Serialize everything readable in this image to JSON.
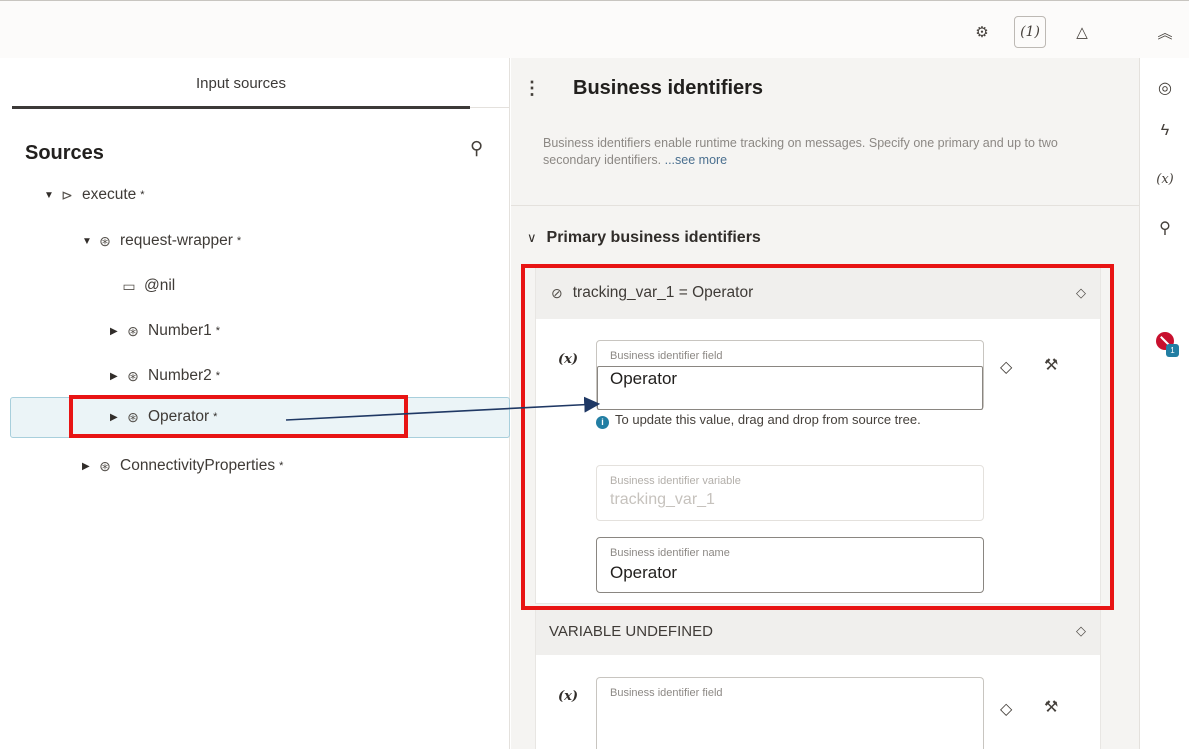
{
  "toolbar": {
    "settings_icon": "gear-icon",
    "variables_button_label": "(1)",
    "warning_icon": "warning-triangle-icon",
    "collapse_icon": "double-chevron-up-icon"
  },
  "left_panel": {
    "tab_label": "Input sources",
    "title": "Sources",
    "search_icon": "search-icon",
    "tree": [
      {
        "label": "execute",
        "expanded": true,
        "required": "*",
        "icon": "operation-icon"
      },
      {
        "label": "request-wrapper",
        "expanded": true,
        "required": "*",
        "icon": "element-icon"
      },
      {
        "label": "@nil",
        "expanded": null,
        "required": "",
        "icon": "attribute-icon"
      },
      {
        "label": "Number1",
        "expanded": false,
        "required": "*",
        "icon": "element-icon"
      },
      {
        "label": "Number2",
        "expanded": false,
        "required": "*",
        "icon": "element-icon"
      },
      {
        "label": "Operator",
        "expanded": false,
        "required": "*",
        "icon": "element-icon",
        "selected": true
      },
      {
        "label": "ConnectivityProperties",
        "expanded": false,
        "required": "*",
        "icon": "element-icon"
      }
    ]
  },
  "right_panel": {
    "title": "Business identifiers",
    "description": "Business identifiers enable runtime tracking on messages. Specify one primary and up to two secondary identifiers.",
    "see_more": "...see more",
    "section_title": "Primary business identifiers",
    "cards": [
      {
        "header": "tracking_var_1 = Operator",
        "field_label": "Business identifier field",
        "field_value": "Operator",
        "hint": "To update this value, drag and drop from source tree.",
        "variable_label": "Business identifier variable",
        "variable_value": "tracking_var_1",
        "name_label": "Business identifier name",
        "name_value": "Operator"
      },
      {
        "header": "VARIABLE UNDEFINED",
        "field_label": "Business identifier field",
        "field_value": ""
      }
    ]
  },
  "fx_label": "(x)",
  "right_rail": {
    "items": [
      "target-icon",
      "lightning-icon",
      "(x)",
      "search-icon",
      "error-badge-icon"
    ],
    "badge_count": "1"
  },
  "colors": {
    "annotation_red": "#e81414",
    "arrow_navy": "#1f3864",
    "selection_bg": "#ebf4f7",
    "info_blue": "#227ea3"
  }
}
